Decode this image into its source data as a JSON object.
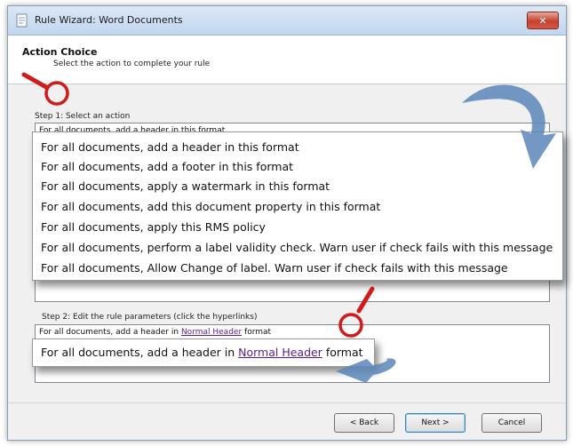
{
  "window": {
    "title": "Rule Wizard: Word Documents",
    "close_glyph": "✕"
  },
  "header": {
    "title": "Action Choice",
    "subtitle": "Select the action to complete your rule"
  },
  "step1": {
    "label": "Step 1: Select an action",
    "selected": "For all documents, add a header in this format",
    "options": [
      "For all documents, add a header in this format",
      "For all documents, add a footer in this format",
      "For all documents, apply a watermark in this format",
      "For all documents, add this document property in this format",
      "For all documents, apply this RMS policy",
      "For all documents, perform a label validity check. Warn user if check fails with this message",
      "For all documents, Allow Change of label. Warn user if check fails with this message"
    ]
  },
  "step2": {
    "label": "Step 2: Edit the rule parameters (click the hyperlinks)",
    "prefix": "For all documents, add a header in",
    "link": "Normal Header",
    "suffix": "format"
  },
  "buttons": {
    "back": "< Back",
    "next": "Next >",
    "cancel": "Cancel"
  },
  "colors": {
    "annotation_red": "#d11a1a",
    "arrow_blue": "#5a86b8",
    "link": "#5a1e8c"
  },
  "icons": [
    "document-icon",
    "close-icon",
    "magnifier-icon",
    "curved-arrow-icon"
  ]
}
